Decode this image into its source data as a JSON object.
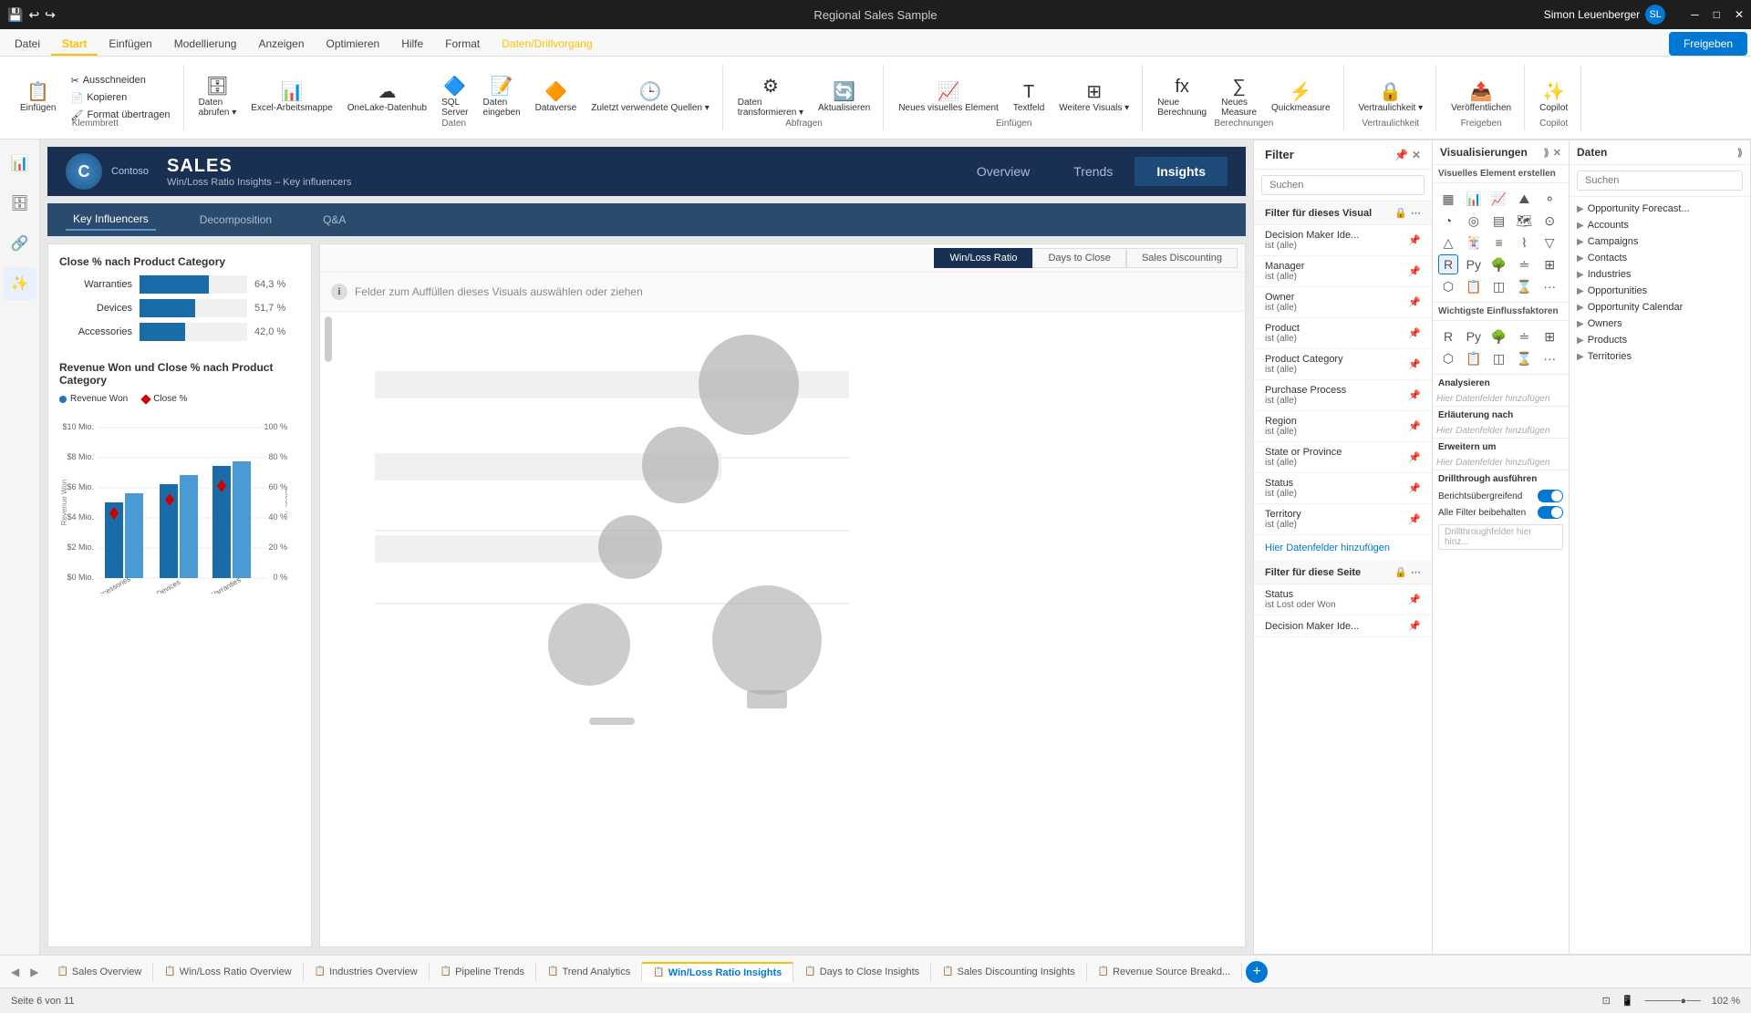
{
  "titlebar": {
    "title": "Regional Sales Sample",
    "user": "Simon Leuenberger",
    "win_min": "─",
    "win_max": "□",
    "win_close": "✕"
  },
  "ribbon": {
    "tabs": [
      {
        "label": "Datei",
        "active": false
      },
      {
        "label": "Start",
        "active": true
      },
      {
        "label": "Einfügen",
        "active": false
      },
      {
        "label": "Modellierung",
        "active": false
      },
      {
        "label": "Anzeigen",
        "active": false
      },
      {
        "label": "Optimieren",
        "active": false
      },
      {
        "label": "Hilfe",
        "active": false
      },
      {
        "label": "Format",
        "active": false
      },
      {
        "label": "Daten/Drillvorgang",
        "active": true,
        "special": true
      }
    ],
    "share_btn": "Freigeben"
  },
  "nav": {
    "logo_text": "Contoso",
    "brand_text": "SALES",
    "subtitle": "Win/Loss Ratio Insights – Key influencers",
    "links": [
      "Overview",
      "Trends",
      "Insights"
    ],
    "active_link": "Insights"
  },
  "sub_nav": {
    "items": [
      "Key Influencers",
      "Decomposition",
      "Q&A"
    ],
    "active": "Key Influencers"
  },
  "tab_pills": {
    "items": [
      "Win/Loss Ratio",
      "Days to Close",
      "Sales Discounting"
    ],
    "active": "Win/Loss Ratio"
  },
  "left_chart": {
    "title1": "Close % nach Product Category",
    "bars": [
      {
        "label": "Warranties",
        "pct": 0.643,
        "value": "64,3 %"
      },
      {
        "label": "Devices",
        "pct": 0.517,
        "value": "51,7 %"
      },
      {
        "label": "Accessories",
        "pct": 0.42,
        "value": "42,0 %"
      }
    ],
    "title2": "Revenue Won und Close % nach Product Category",
    "legend": [
      {
        "label": "Revenue Won",
        "type": "dot",
        "color": "#1f77b4"
      },
      {
        "label": "Close %",
        "type": "diamond",
        "color": "#cc0000"
      }
    ],
    "yaxis_left": [
      "$10 Mio.",
      "$8 Mio.",
      "$6 Mio.",
      "$4 Mio.",
      "$2 Mio.",
      "$0 Mio."
    ],
    "yaxis_right": [
      "100 %",
      "80 %",
      "60 %",
      "40 %",
      "20 %",
      "0 %"
    ],
    "xaxis": [
      "Accessories",
      "Devices",
      "Warranties"
    ]
  },
  "main_visual": {
    "placeholder_text": "Felder zum Auffüllen dieses Visuals auswählen oder ziehen",
    "bubbles": [
      {
        "x": 55,
        "y": 38,
        "size": 100
      },
      {
        "x": 43,
        "y": 55,
        "size": 78
      },
      {
        "x": 32,
        "y": 70,
        "size": 65
      },
      {
        "x": 75,
        "y": 60,
        "size": 90
      },
      {
        "x": 72,
        "y": 78,
        "size": 115
      }
    ]
  },
  "filter_panel": {
    "title": "Filter",
    "section_visual": "Filter für dieses Visual",
    "filters": [
      {
        "name": "Decision Maker Ide...",
        "value": "ist (alle)"
      },
      {
        "name": "Manager",
        "value": "ist (alle)"
      },
      {
        "name": "Owner",
        "value": "ist (alle)"
      },
      {
        "name": "Product",
        "value": "ist (alle)"
      },
      {
        "name": "Product Category",
        "value": "ist (alle)"
      },
      {
        "name": "Purchase Process",
        "value": "ist (alle)"
      },
      {
        "name": "Region",
        "value": "ist (alle)"
      },
      {
        "name": "State or Province",
        "value": "ist (alle)"
      },
      {
        "name": "Status",
        "value": "ist (alle)"
      },
      {
        "name": "Territory",
        "value": "ist (alle)"
      }
    ],
    "add_field": "Hier Datenfelder hinzufügen",
    "section_page": "Filter für diese Seite",
    "page_filters": [
      {
        "name": "Status",
        "value": "ist Lost oder Won"
      },
      {
        "name": "Decision Maker Ide...",
        "value": ""
      }
    ]
  },
  "viz_panel": {
    "title": "Visualisierungen",
    "create_title": "Visuelles Element erstellen",
    "sections": {
      "analyze_title": "Analysieren",
      "analyze_placeholder": "Hier Datenfelder hinzufügen",
      "explain_title": "Erläuterung nach",
      "explain_placeholder": "Hier Datenfelder hinzufügen",
      "expand_title": "Erweitern um",
      "expand_placeholder": "Hier Datenfelder hinzufügen",
      "drill_title": "Drillthrough ausführen",
      "report_toggle": "Berichtsübergreifend",
      "filter_toggle": "Alle Filter beibehalten",
      "drill_field": "Drillthroughfelder hier hinz..."
    }
  },
  "data_panel": {
    "title": "Daten",
    "items": [
      {
        "label": "Opportunity Forecast...",
        "indent": 1
      },
      {
        "label": "Accounts",
        "indent": 1
      },
      {
        "label": "Campaigns",
        "indent": 1
      },
      {
        "label": "Contacts",
        "indent": 1
      },
      {
        "label": "Industries",
        "indent": 1
      },
      {
        "label": "Opportunities",
        "indent": 1
      },
      {
        "label": "Opportunity Calendar",
        "indent": 1
      },
      {
        "label": "Owners",
        "indent": 1
      },
      {
        "label": "Products",
        "indent": 1
      },
      {
        "label": "Territories",
        "indent": 1
      }
    ]
  },
  "page_tabs": {
    "tabs": [
      {
        "label": "Sales Overview"
      },
      {
        "label": "Win/Loss Ratio Overview"
      },
      {
        "label": "Industries Overview"
      },
      {
        "label": "Pipeline Trends"
      },
      {
        "label": "Trend Analytics"
      },
      {
        "label": "Win/Loss Ratio Insights",
        "active": true
      },
      {
        "label": "Days to Close Insights"
      },
      {
        "label": "Sales Discounting Insights"
      },
      {
        "label": "Revenue Source Breakd..."
      }
    ]
  },
  "status_bar": {
    "page_info": "Seite 6 von 11",
    "zoom": "102 %"
  }
}
